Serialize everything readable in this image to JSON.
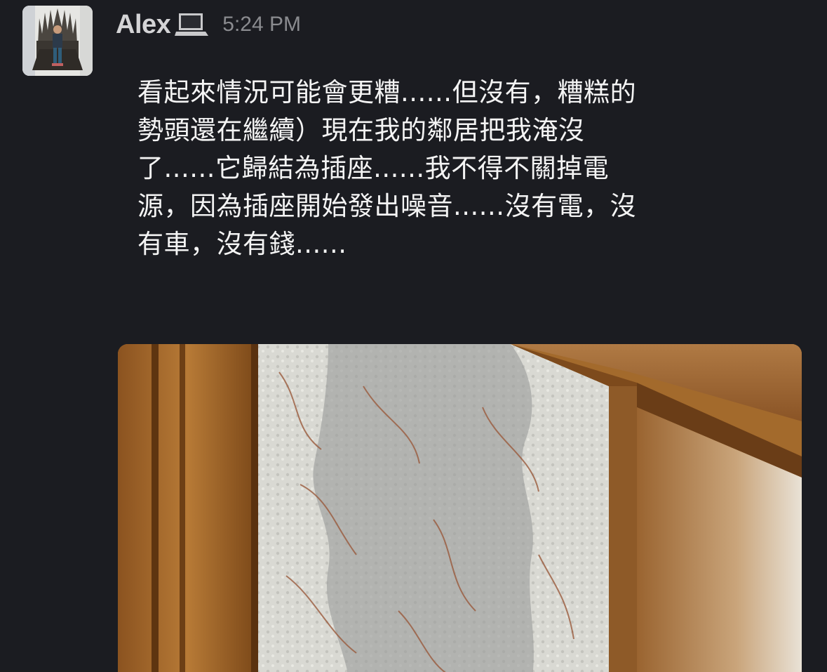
{
  "message": {
    "author": "Alex",
    "device_icon": "laptop-icon",
    "timestamp": "5:24 PM",
    "lines": [
      "看起來情況可能會更糟......但沒有，糟糕的",
      "勢頭還在繼續）現在我的鄰居把我淹沒",
      "了......它歸結為插座......我不得不關掉電",
      "源，因為插座開始發出噪音......沒有電，沒",
      "有車，沒有錢......"
    ]
  },
  "colors": {
    "background": "#1b1c21",
    "author": "#d4d4d6",
    "timestamp": "#8a8b8f",
    "text": "#f4f4f4"
  }
}
